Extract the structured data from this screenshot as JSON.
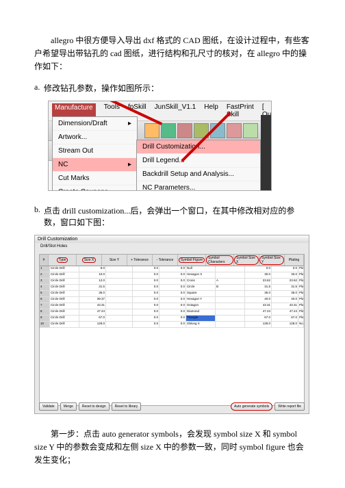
{
  "intro": "allegro 中很方便导入导出 dxf 格式的 CAD 图纸，在设计过程中，有些客户希望导出带钻孔的 cad 图纸，进行结构和孔尺寸的核对，在 allegro 中的操作如下：",
  "list_a_marker": "a.",
  "list_a": "修改钻孔参数，操作如图所示：",
  "list_b_marker": "b.",
  "list_b": "点击 drill customization...后，会弹出一个窗口，在其中修改相对应的参数，窗口如下图：",
  "menu": {
    "items": [
      "Manufacture",
      "Tools",
      "fpSkill",
      "JunSkill_V1.1",
      "Help",
      "FastPrint Skill",
      "[ Qui"
    ]
  },
  "dropdown": {
    "items": [
      {
        "label": "Dimension/Draft",
        "arrow": true
      },
      {
        "label": "Artwork..."
      },
      {
        "label": "Stream Out"
      },
      {
        "label": "NC",
        "arrow": true,
        "hilite": true
      },
      {
        "label": "Cut Marks"
      },
      {
        "label": "Create Coupons..."
      }
    ]
  },
  "submenu": {
    "items": [
      {
        "label": "Drill Customization...",
        "hilite": true
      },
      {
        "label": "Drill Legend..."
      },
      {
        "label": "Backdrill Setup and Analysis..."
      },
      {
        "label": "NC Parameters..."
      }
    ]
  },
  "window2": {
    "title": "Drill Customization",
    "section": "Drill/Slot Holes",
    "headers": [
      "#",
      "Type",
      "Size X",
      "Size Y",
      "+ Tolerance",
      "- Tolerance",
      "Symbol Figure",
      "Symbol Characters",
      "Symbol Size X",
      "Symbol Size Y",
      "Plating"
    ],
    "ovals": [
      false,
      true,
      true,
      false,
      false,
      false,
      true,
      true,
      true,
      true,
      false
    ],
    "rows": [
      {
        "i": "1",
        "type": "Circle Drill",
        "sx": "8.0",
        "sy": "",
        "tp": "0.0",
        "tm": "0.0",
        "fig": "Null",
        "ch": "",
        "sxx": "0.0",
        "syy": "0.0",
        "pl": "Plated"
      },
      {
        "i": "2",
        "type": "Circle Drill",
        "sx": "10.0",
        "sy": "",
        "tp": "0.0",
        "tm": "0.0",
        "fig": "Hexagon X",
        "ch": "",
        "sxx": "30.0",
        "syy": "30.0",
        "pl": "Plated"
      },
      {
        "i": "3",
        "type": "Circle Drill",
        "sx": "12.0",
        "sy": "",
        "tp": "0.0",
        "tm": "0.0",
        "fig": "Cross",
        "ch": "A",
        "sxx": "23.62",
        "syy": "23.62",
        "pl": "Plated"
      },
      {
        "i": "4",
        "type": "Circle Drill",
        "sx": "31.5",
        "sy": "",
        "tp": "0.0",
        "tm": "0.0",
        "fig": "Circle",
        "ch": "B",
        "sxx": "31.5",
        "syy": "31.5",
        "pl": "Plated"
      },
      {
        "i": "5",
        "type": "Circle Drill",
        "sx": "36.0",
        "sy": "",
        "tp": "0.0",
        "tm": "0.0",
        "fig": "Square",
        "ch": "",
        "sxx": "36.0",
        "syy": "36.0",
        "pl": "Plated"
      },
      {
        "i": "6",
        "type": "Circle Drill",
        "sx": "39.37",
        "sy": "",
        "tp": "0.0",
        "tm": "0.0",
        "fig": "Hexagon Y",
        "ch": "",
        "sxx": "40.0",
        "syy": "40.0",
        "pl": "Plated"
      },
      {
        "i": "7",
        "type": "Circle Drill",
        "sx": "43.31",
        "sy": "",
        "tp": "0.0",
        "tm": "0.0",
        "fig": "Octagon",
        "ch": "",
        "sxx": "43.31",
        "syy": "43.31",
        "pl": "Plated"
      },
      {
        "i": "8",
        "type": "Circle Drill",
        "sx": "47.24",
        "sy": "",
        "tp": "0.0",
        "tm": "0.0",
        "fig": "Diamond",
        "ch": "",
        "sxx": "47.24",
        "syy": "47.24",
        "pl": "Plated"
      },
      {
        "i": "9",
        "type": "Circle Drill",
        "sx": "67.0",
        "sy": "",
        "tp": "0.0",
        "tm": "0.0",
        "fig": "Triangle",
        "ch": "",
        "sxx": "67.0",
        "syy": "67.0",
        "pl": "Plated",
        "sel": true
      },
      {
        "i": "10",
        "type": "Circle Drill",
        "sx": "128.0",
        "sy": "",
        "tp": "0.0",
        "tm": "0.0",
        "fig": "Oblong X",
        "ch": "",
        "sxx": "128.0",
        "syy": "128.0",
        "pl": "Non-Plated"
      }
    ],
    "buttons_l": [
      "Validate",
      "Merge",
      "Reset to design",
      "Reset to library"
    ],
    "buttons_r": [
      "Auto generate symbols",
      "Write report file"
    ]
  },
  "footer": "第一步：点击 auto generator symbols，会发现 symbol size X 和 symbol size Y 中的参数会变成和左侧 size X 中的参数一致，同时 symbol figure 也会发生变化；"
}
